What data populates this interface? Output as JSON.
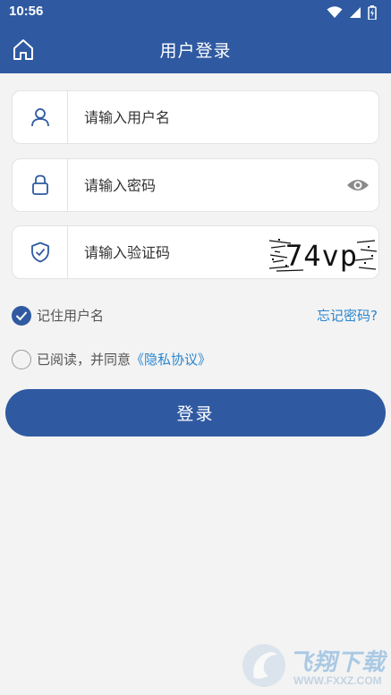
{
  "status_bar": {
    "time": "10:56",
    "icons": [
      "wifi-icon",
      "signal-icon",
      "battery-icon"
    ]
  },
  "header": {
    "title": "用户登录",
    "home_icon": "home-icon"
  },
  "form": {
    "username": {
      "placeholder": "请输入用户名",
      "value": "",
      "icon": "user-icon"
    },
    "password": {
      "placeholder": "请输入密码",
      "value": "",
      "icon": "lock-icon",
      "toggle_icon": "eye-icon"
    },
    "captcha": {
      "placeholder": "请输入验证码",
      "value": "",
      "icon": "shield-check-icon",
      "image_text": "74vp"
    }
  },
  "options": {
    "remember_label": "记住用户名",
    "remember_checked": true,
    "forgot_label": "忘记密码?",
    "agree_prefix": "已阅读，并同意",
    "privacy_link": "《隐私协议》",
    "agree_checked": false
  },
  "login_button": {
    "label": "登录"
  },
  "watermark": {
    "text": "飞翔下载",
    "url": "WWW.FXXZ.COM"
  },
  "colors": {
    "primary": "#2f5aa1",
    "link": "#2a86cf",
    "background": "#f3f3f3"
  }
}
